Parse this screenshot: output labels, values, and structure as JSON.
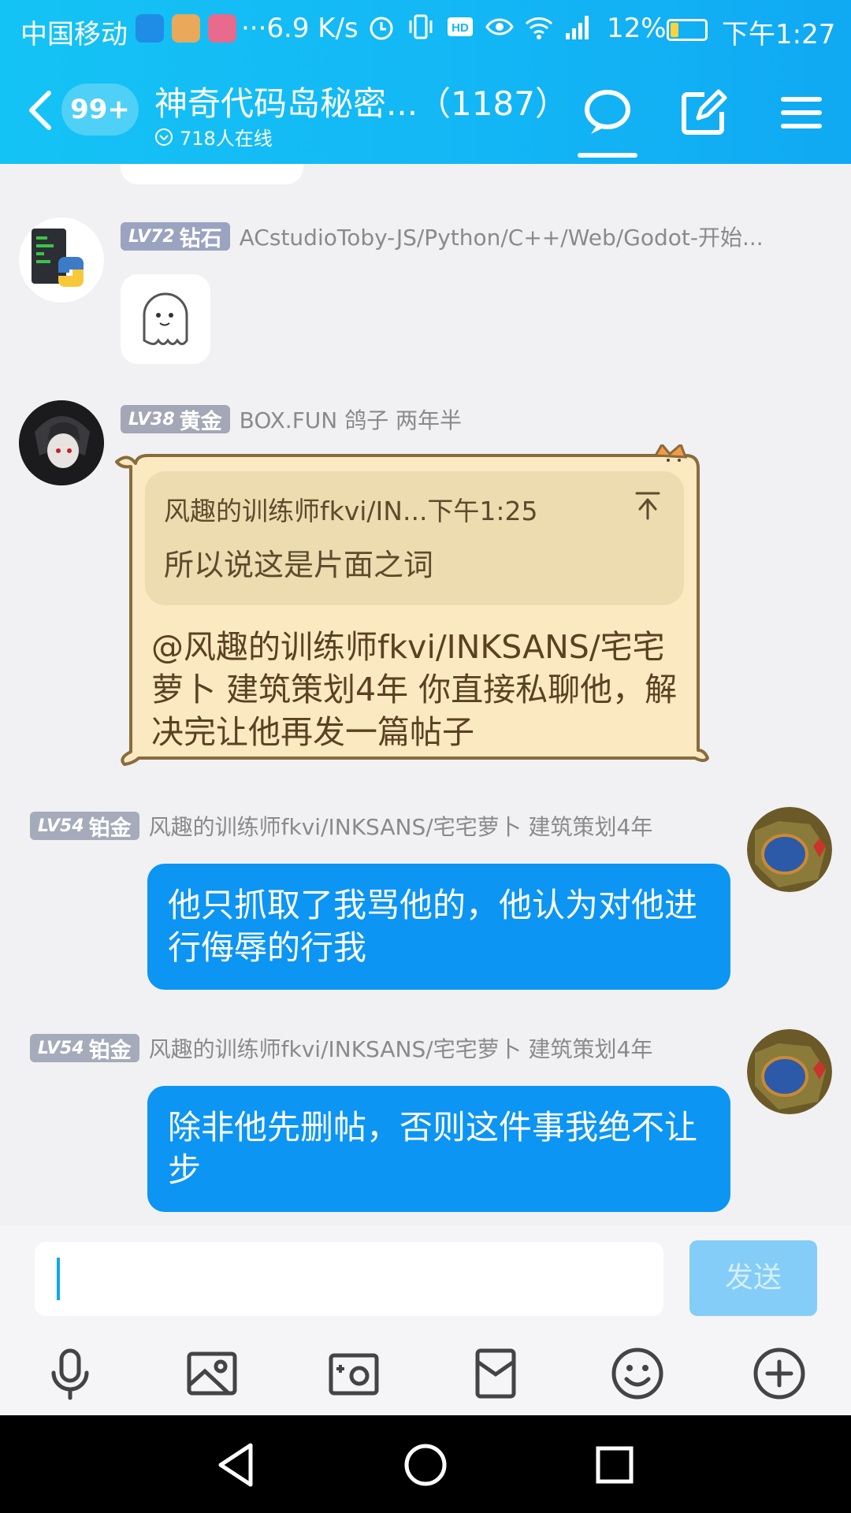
{
  "status_bar": {
    "carrier": "中国移动",
    "speed": "···6.9 K/s",
    "battery": "12%",
    "time": "下午1:27"
  },
  "header": {
    "unread_badge": "99+",
    "group_title": "神奇代码岛秘密...（1187）",
    "online_count": "718人在线"
  },
  "messages": [
    {
      "level": "LV72",
      "rank": "钻石",
      "sender": "ACstudioToby-JS/Python/C++/Web/Godot-开始...",
      "content": "ghost-sticker"
    },
    {
      "level": "LV38",
      "rank": "黄金",
      "sender": "BOX.FUN 鸽子 两年半",
      "quote": {
        "author_time": "风趣的训练师fkvi/IN...下午1:25",
        "text": "所以说这是片面之词"
      },
      "text": "@风趣的训练师fkvi/INKSANS/宅宅萝卜 建筑策划4年 你直接私聊他，解决完让他再发一篇帖子"
    },
    {
      "level": "LV54",
      "rank": "铂金",
      "sender": "风趣的训练师fkvi/INKSANS/宅宅萝卜 建筑策划4年",
      "text": "他只抓取了我骂他的，他认为对他进行侮辱的行我"
    },
    {
      "level": "LV54",
      "rank": "铂金",
      "sender": "风趣的训练师fkvi/INKSANS/宅宅萝卜 建筑策划4年",
      "text": "除非他先删帖，否则这件事我绝不让步"
    }
  ],
  "input": {
    "value": "",
    "send_label": "发送"
  },
  "toolbar": [
    "mic-icon",
    "image-icon",
    "camera-icon",
    "red-packet-icon",
    "emoji-icon",
    "plus-icon"
  ],
  "colors": {
    "header": "#13b7f5",
    "self_bubble": "#0c95f3",
    "send_button": "#84cdf8",
    "level_badge": "#a3a7b6"
  }
}
